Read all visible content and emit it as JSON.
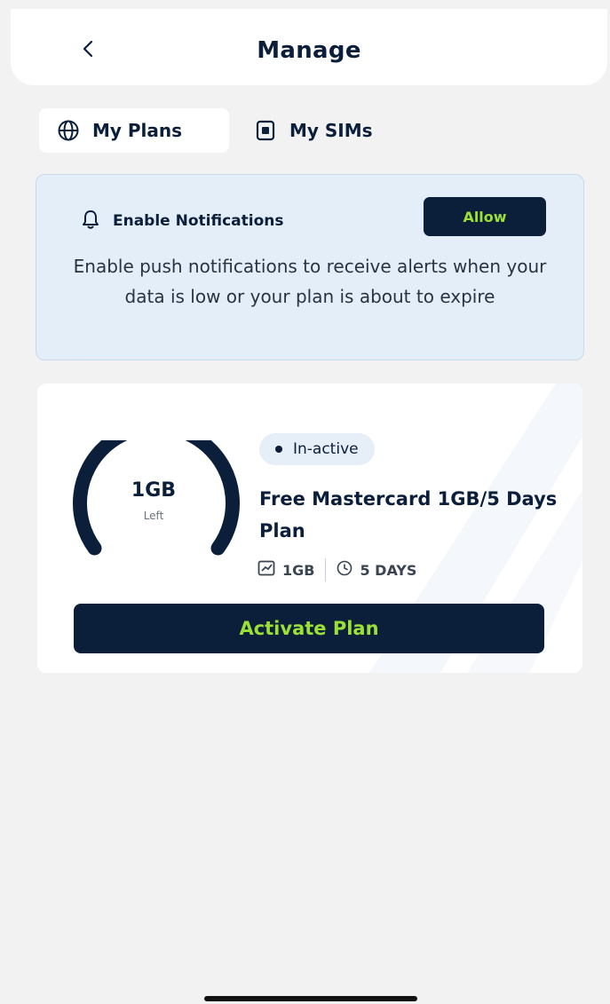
{
  "header": {
    "title": "Manage",
    "back_icon": "chevron-left-icon"
  },
  "tabs": [
    {
      "label": "My Plans",
      "icon": "globe-icon",
      "active": true
    },
    {
      "label": "My SIMs",
      "icon": "sim-card-icon",
      "active": false
    }
  ],
  "notification": {
    "icon": "bell-icon",
    "title": "Enable Notifications",
    "allow_label": "Allow",
    "body": "Enable push notifications to receive alerts when your data is low or your plan is about to expire"
  },
  "plan": {
    "gauge_value": "1GB",
    "gauge_sub": "Left",
    "status": "In-active",
    "name": "Free Mastercard 1GB/5 Days Plan",
    "data_amount": "1GB",
    "duration": "5 DAYS",
    "activate_label": "Activate Plan"
  },
  "colors": {
    "navy": "#0b1f3a",
    "accent_green": "#9be037",
    "banner_bg": "#e4eef8",
    "page_bg": "#f2f2f3"
  }
}
